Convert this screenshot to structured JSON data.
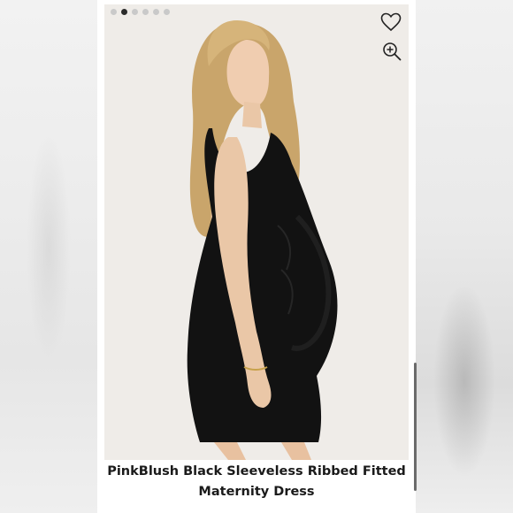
{
  "carousel": {
    "total_slides": 6,
    "active_index": 1
  },
  "icons": {
    "favorite": "heart-outline-icon",
    "zoom": "zoom-in-icon"
  },
  "product": {
    "title": "PinkBlush Black Sleeveless Ribbed Fitted Maternity Dress"
  },
  "colors": {
    "dress": "#121212",
    "photo_bg": "#efece8",
    "text": "#1a1a1a"
  }
}
